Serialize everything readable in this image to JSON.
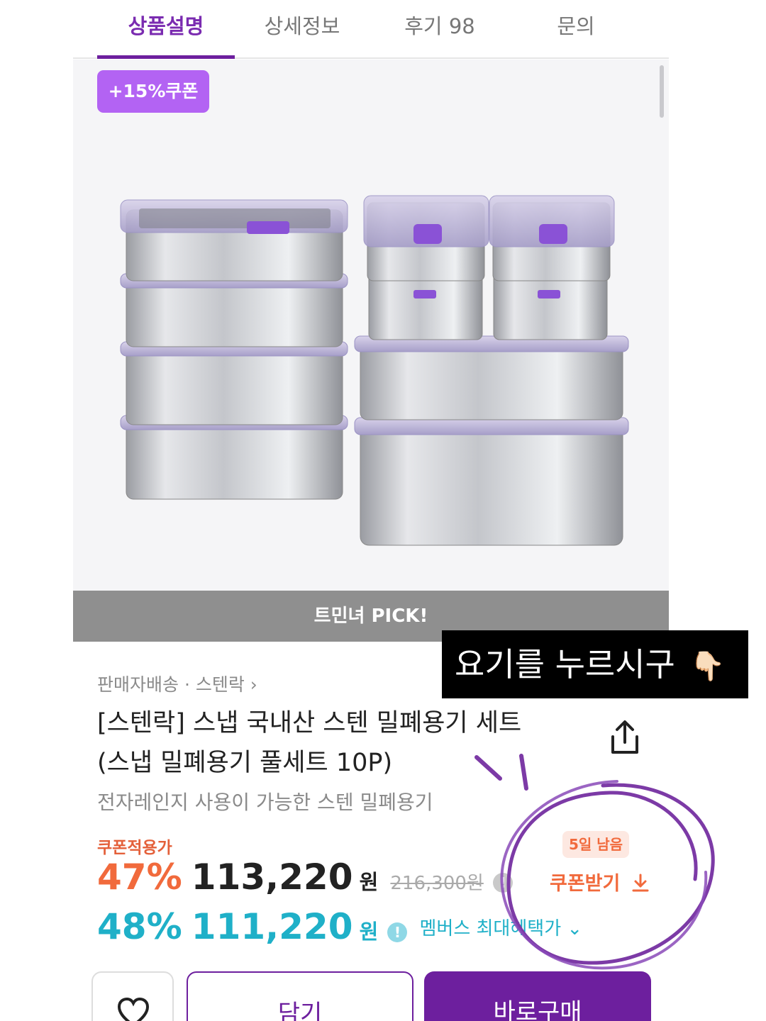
{
  "tabs": [
    {
      "label": "상품설명",
      "active": true
    },
    {
      "label": "상세정보",
      "active": false
    },
    {
      "label": "후기 98",
      "active": false
    },
    {
      "label": "문의",
      "active": false
    }
  ],
  "hero": {
    "coupon_badge": "+15%쿠폰",
    "pick_label": "트민녀 PICK!"
  },
  "product": {
    "seller": "판매자배송 · 스텐락",
    "title_line1": "[스텐락] 스냅 국내산 스텐 밀폐용기 세트",
    "title_line2": "(스냅 밀폐용기 풀세트 10P)",
    "subtitle": "전자레인지 사용이 가능한 스텐 밀폐용기"
  },
  "pricing": {
    "coupon_label": "쿠폰적용가",
    "row1": {
      "discount": "47%",
      "amount": "113,220",
      "unit": "원",
      "original": "216,300원"
    },
    "row2": {
      "discount": "48%",
      "amount": "111,220",
      "unit": "원",
      "members_text": "멤버스 최대혜택가 ⌄"
    },
    "info_glyph": "!"
  },
  "coupon": {
    "days_left": "5일 남음",
    "download_label": "쿠폰받기"
  },
  "actions": {
    "cart_label": "담기",
    "buy_label": "바로구매"
  },
  "annotation": {
    "callout_text": "요기를 누르시구",
    "hand_emoji": "👇🏻"
  },
  "colors": {
    "brand_purple": "#6d1f9e",
    "coupon_badge": "#b363f3",
    "orange": "#f16a3c",
    "teal": "#1fb0c8"
  }
}
